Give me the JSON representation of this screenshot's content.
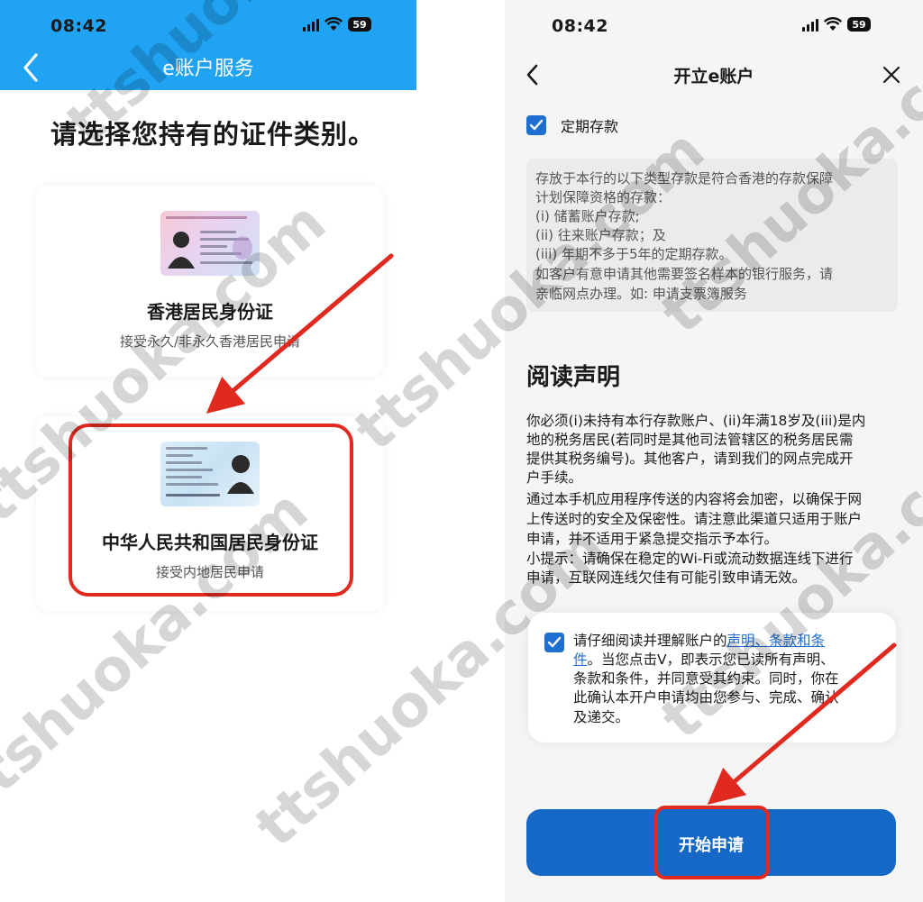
{
  "left": {
    "status": {
      "time": "08:42",
      "battery": "59"
    },
    "header": {
      "title": "e账户服务"
    },
    "prompt": "请选择您持有的证件类别。",
    "cards": [
      {
        "name": "香港居民身份证",
        "desc": "接受永久/非永久香港居民申请"
      },
      {
        "name": "中华人民共和国居民身份证",
        "desc": "接受内地居民申请"
      }
    ]
  },
  "right": {
    "status": {
      "time": "08:42",
      "battery": "59"
    },
    "header": {
      "title": "开立e账户"
    },
    "fixed_deposit": {
      "label": "定期存款",
      "checked": true
    },
    "info_lines": [
      "存放于本行的以下类型存款是符合香港的存款保障",
      "计划保障资格的存款：",
      "(i) 储蓄账户存款;",
      "(ii) 往来账户存款；及",
      "(iii) 年期不多于5年的定期存款。",
      "如客户有意申请其他需要签名样本的银行服务，请",
      "亲临网点办理。如: 申请支票簿服务"
    ],
    "statement_title": "阅读声明",
    "statement_lines": [
      "你必须(i)未持有本行存款账户、(ii)年满18岁及(iii)是内",
      "地的税务居民(若同时是其他司法管辖区的税务居民需",
      "提供其税务编号)。其他客户，请到我们的网点完成开",
      "户手续。",
      "通过本手机应用程序传送的内容将会加密，以确保于网",
      "上传送时的安全及保密性。请注意此渠道只适用于账户",
      "申请，并不适用于紧急提交指示予本行。",
      "小提示：请确保在稳定的Wi-Fi或流动数据连线下进行",
      "申请，互联网连线欠佳有可能引致申请无效。"
    ],
    "agreement": {
      "checked": true,
      "prefix": "请仔细阅读并理解账户的",
      "link_part1": "声明、条款和条",
      "link_part2": "件",
      "line2_rest": "。当您点击V，即表示您已读所有声明、",
      "line3": "条款和条件，并同意受其约束。同时，你在",
      "line4": "此确认本开户申请均由您参与、完成、确认",
      "line5": "及递交。"
    },
    "start_button": "开始申请"
  },
  "watermark": "ttshuoka.com",
  "colors": {
    "header_blue": "#1fa3f2",
    "primary_blue": "#1668c7",
    "highlight_red": "#e12a1f"
  }
}
